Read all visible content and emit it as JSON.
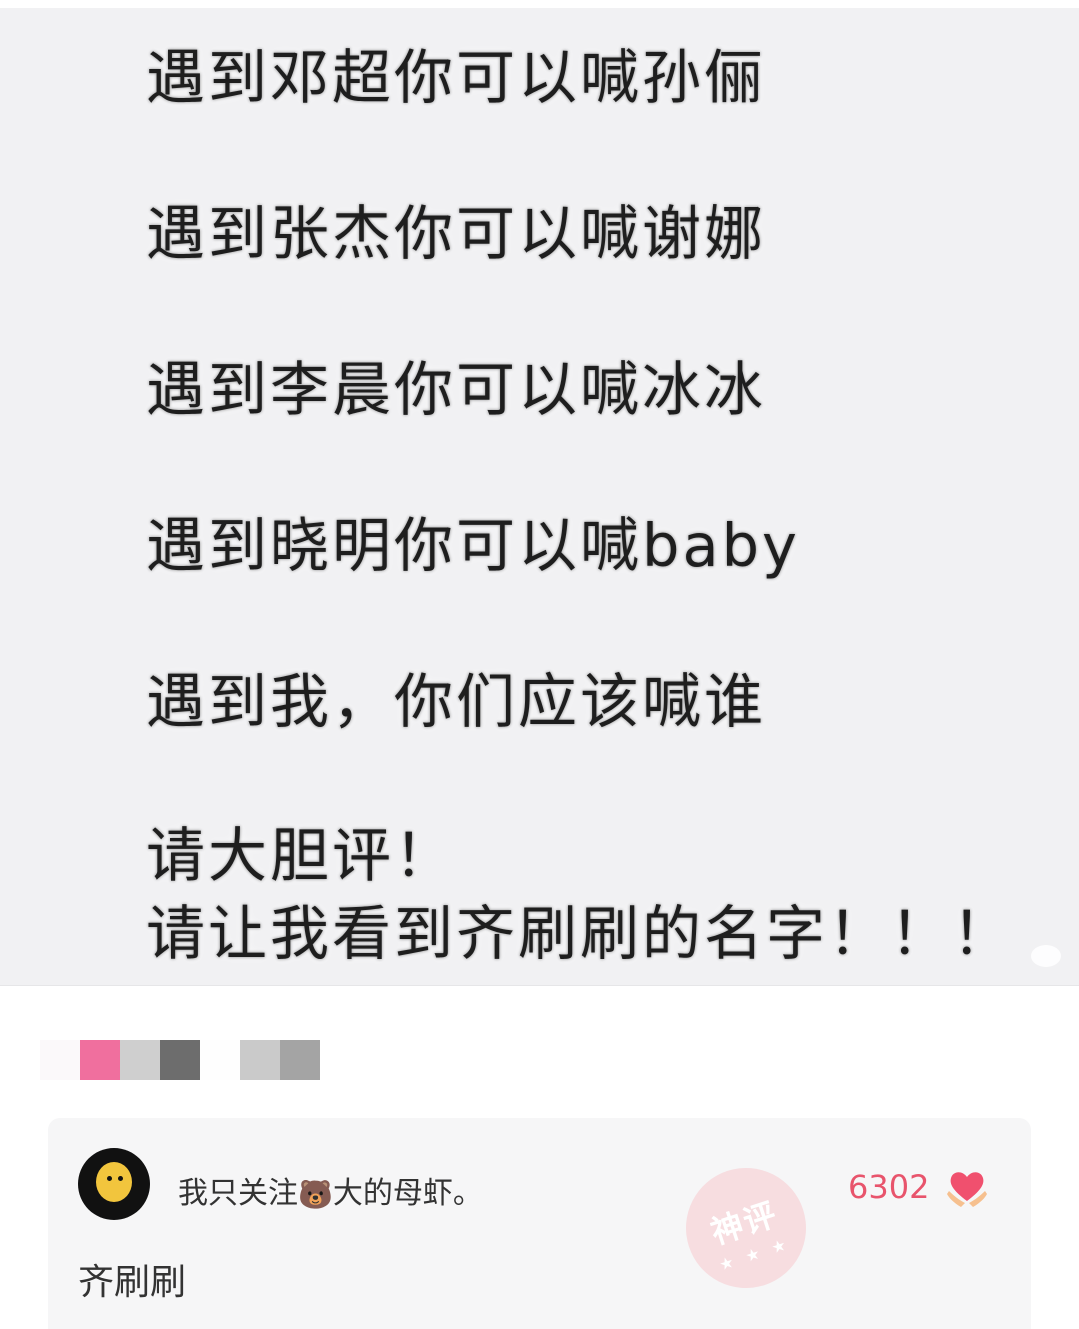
{
  "meme": {
    "lines": [
      "遇到邓超你可以喊孙俪",
      "遇到张杰你可以喊谢娜",
      "遇到李晨你可以喊冰冰",
      "遇到晓明你可以喊baby",
      "遇到我，你们应该喊谁",
      "请大胆评！",
      "请让我看到齐刷刷的名字！！！"
    ],
    "watermark_icon": "weibo-logo-icon"
  },
  "mosaic": {
    "colors": [
      "#fbf9fa",
      "#f06f9e",
      "#cfcfcf",
      "#6d6d6d",
      "#fefefe",
      "#cacaca",
      "#a4a4a4"
    ]
  },
  "comment": {
    "username": "我只关注",
    "username_emoji": "🐻",
    "username_suffix": "大的母虾。",
    "like_count": "6302",
    "like_icon": "heart-hands-icon",
    "badge_text": "神评",
    "badge_stars": "★ ★ ★",
    "text": "齐刷刷",
    "accent_color": "#e8546c"
  }
}
